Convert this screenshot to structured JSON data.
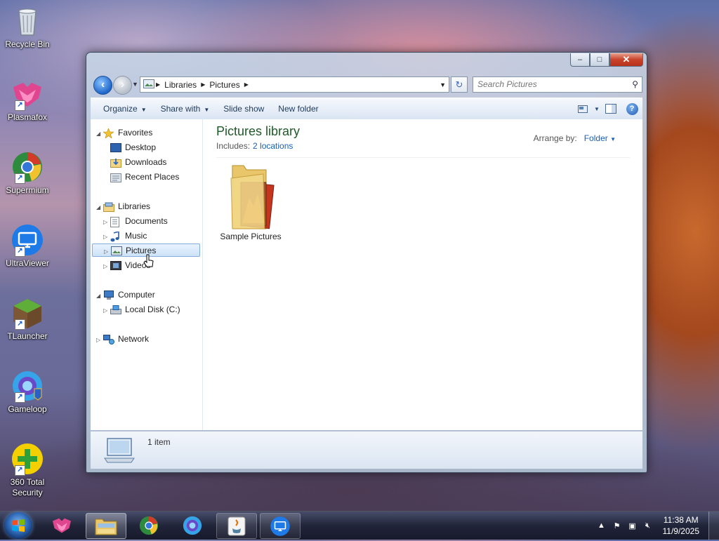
{
  "desktop": {
    "icons": [
      {
        "label": "Recycle Bin",
        "icon": "recycle-bin-icon"
      },
      {
        "label": "Plasmafox",
        "icon": "plasmafox-icon"
      },
      {
        "label": "Supermium",
        "icon": "supermium-icon"
      },
      {
        "label": "UltraViewer",
        "icon": "ultraviewer-icon"
      },
      {
        "label": "TLauncher",
        "icon": "tlauncher-icon"
      },
      {
        "label": "Gameloop",
        "icon": "gameloop-icon"
      },
      {
        "label": "360 Total Security",
        "icon": "360-total-security-icon"
      }
    ]
  },
  "window": {
    "caption_buttons": {
      "minimize": "–",
      "maximize": "□",
      "close": "✕"
    },
    "address": {
      "segments": [
        "Libraries",
        "Pictures"
      ]
    },
    "search": {
      "placeholder": "Search Pictures"
    },
    "toolbar": {
      "organize": "Organize",
      "share_with": "Share with",
      "slide_show": "Slide show",
      "new_folder": "New folder"
    },
    "nav": {
      "favorites": "Favorites",
      "desktop": "Desktop",
      "downloads": "Downloads",
      "recent_places": "Recent Places",
      "libraries": "Libraries",
      "documents": "Documents",
      "music": "Music",
      "pictures": "Pictures",
      "videos": "Videos",
      "computer": "Computer",
      "local_disk": "Local Disk (C:)",
      "network": "Network"
    },
    "library": {
      "title": "Pictures library",
      "includes_label": "Includes:",
      "locations_link": "2 locations",
      "arrange_label": "Arrange by:",
      "arrange_value": "Folder"
    },
    "items": [
      {
        "name": "Sample Pictures"
      }
    ],
    "details": {
      "count": "1 item"
    }
  },
  "taskbar": {
    "clock": {
      "time": "11:38 AM",
      "date": "11/9/2025"
    },
    "apps": [
      "plasmafox",
      "windows-explorer",
      "supermium",
      "gameloop",
      "java",
      "ultraviewer"
    ]
  }
}
